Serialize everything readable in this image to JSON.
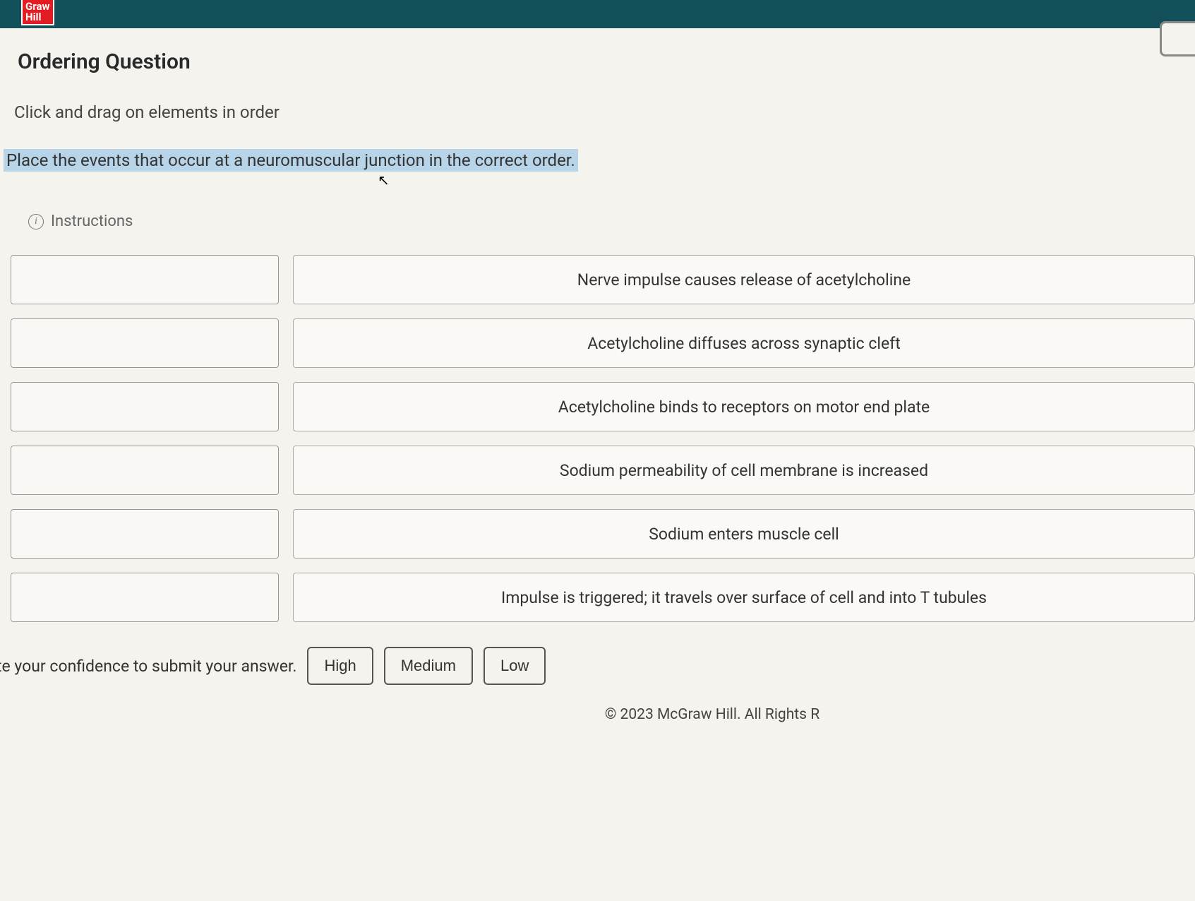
{
  "logo": {
    "line1": "Graw",
    "line2": "Hill"
  },
  "header": {
    "question_type": "Ordering Question",
    "instruction": "Click and drag on elements in order",
    "prompt": "Place the events that occur at a neuromuscular junction in the correct order.",
    "instructions_label": "Instructions"
  },
  "items": [
    "Nerve impulse causes release of acetylcholine",
    "Acetylcholine diffuses across synaptic cleft",
    "Acetylcholine binds to receptors on motor end plate",
    "Sodium permeability of cell membrane is increased",
    "Sodium enters muscle cell",
    "Impulse is triggered; it travels over surface of cell and into T tubules"
  ],
  "footer": {
    "confidence_text": "te your confidence to submit your answer.",
    "buttons": {
      "high": "High",
      "medium": "Medium",
      "low": "Low"
    },
    "copyright": "© 2023 McGraw Hill. All Rights R"
  }
}
